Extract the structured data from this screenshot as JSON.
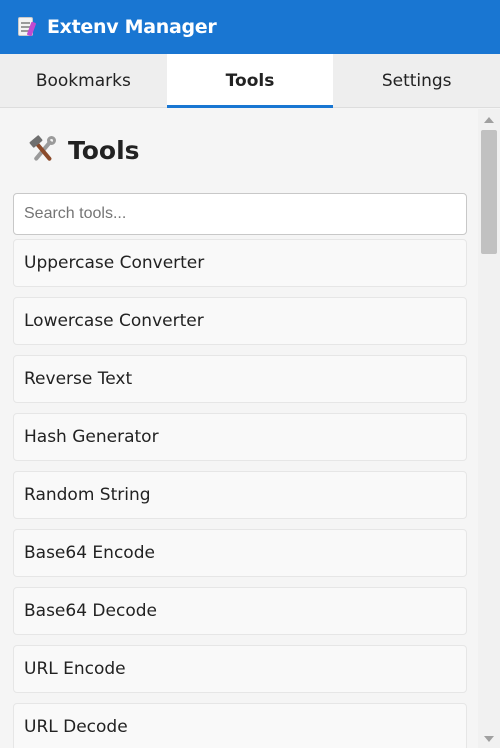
{
  "app": {
    "title": "Extenv Manager",
    "logo_icon": "notepad-pencil-icon",
    "accent_color": "#1976d2"
  },
  "tabs": [
    {
      "label": "Bookmarks",
      "active": false
    },
    {
      "label": "Tools",
      "active": true
    },
    {
      "label": "Settings",
      "active": false
    }
  ],
  "page": {
    "heading": "Tools",
    "heading_icon": "hammer-wrench-icon"
  },
  "search": {
    "placeholder": "Search tools...",
    "value": ""
  },
  "tools": [
    {
      "label": "Uppercase Converter"
    },
    {
      "label": "Lowercase Converter"
    },
    {
      "label": "Reverse Text"
    },
    {
      "label": "Hash Generator"
    },
    {
      "label": "Random String"
    },
    {
      "label": "Base64 Encode"
    },
    {
      "label": "Base64 Decode"
    },
    {
      "label": "URL Encode"
    },
    {
      "label": "URL Decode"
    }
  ]
}
